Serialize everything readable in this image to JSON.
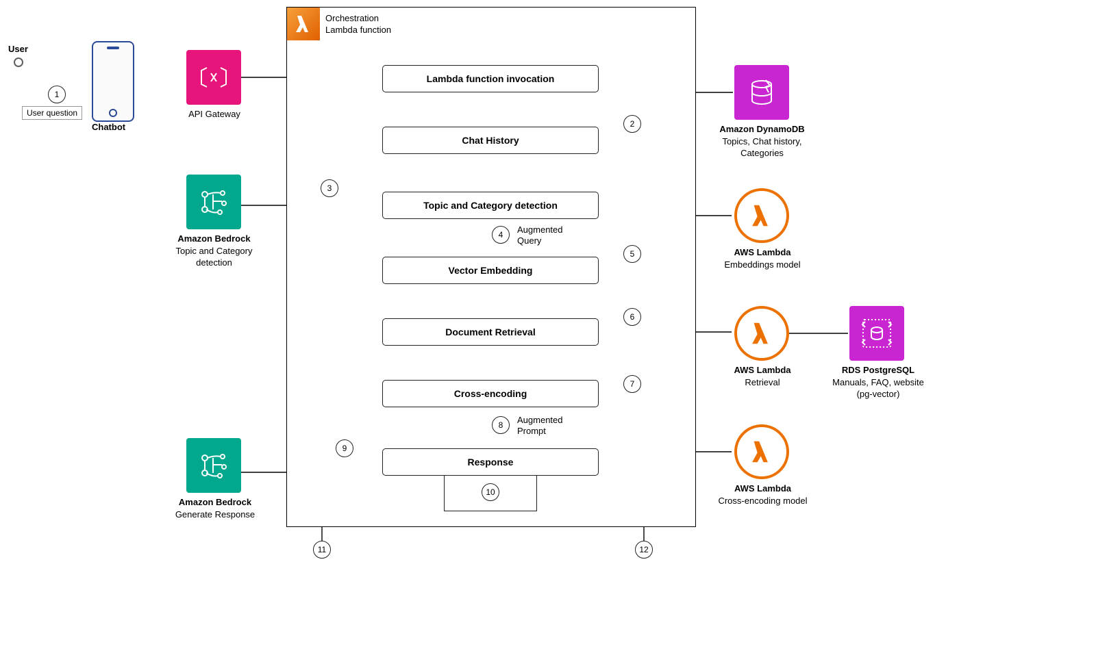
{
  "user": {
    "label": "User"
  },
  "userQuestion": {
    "tag": "User question",
    "step": "1"
  },
  "chatbot": {
    "label": "Chatbot"
  },
  "apiGateway": {
    "label": "API Gateway"
  },
  "bedrockTopic": {
    "title": "Amazon Bedrock",
    "sub": "Topic and Category detection"
  },
  "bedrockResp": {
    "title": "Amazon Bedrock",
    "sub": "Generate Response"
  },
  "orchestration": {
    "line1": "Orchestration",
    "line2": "Lambda function"
  },
  "steps": {
    "invoke": "Lambda function invocation",
    "history": "Chat History",
    "topic": "Topic and Category detection",
    "embed": "Vector Embedding",
    "retrieve": "Document Retrieval",
    "cross": "Cross-encoding",
    "response": "Response"
  },
  "annotations": {
    "augQuery": "Augmented Query",
    "augPrompt": "Augmented Prompt"
  },
  "numbers": {
    "n1": "1",
    "n2": "2",
    "n3": "3",
    "n4": "4",
    "n5": "5",
    "n6": "6",
    "n7": "7",
    "n8": "8",
    "n9": "9",
    "n10": "10",
    "n11": "11",
    "n12": "12"
  },
  "right": {
    "dynamo": {
      "title": "Amazon DynamoDB",
      "sub": "Topics, Chat history, Categories"
    },
    "lambdaEmbed": {
      "title": "AWS Lambda",
      "sub": "Embeddings model"
    },
    "lambdaRetrieve": {
      "title": "AWS Lambda",
      "sub": "Retrieval"
    },
    "lambdaCross": {
      "title": "AWS Lambda",
      "sub": "Cross-encoding model"
    },
    "rds": {
      "title": "RDS PostgreSQL",
      "sub": "Manuals, FAQ, website (pg-vector)"
    }
  },
  "chart_data": {
    "type": "flow-diagram",
    "nodes": [
      {
        "id": "user",
        "label": "User"
      },
      {
        "id": "chatbot",
        "label": "Chatbot"
      },
      {
        "id": "apigw",
        "label": "API Gateway"
      },
      {
        "id": "bedrock_topic",
        "label": "Amazon Bedrock — Topic and Category detection"
      },
      {
        "id": "bedrock_resp",
        "label": "Amazon Bedrock — Generate Response"
      },
      {
        "id": "orchestration",
        "label": "Orchestration Lambda function",
        "group": true
      },
      {
        "id": "invoke",
        "label": "Lambda function invocation",
        "parent": "orchestration"
      },
      {
        "id": "history",
        "label": "Chat History",
        "parent": "orchestration"
      },
      {
        "id": "topic",
        "label": "Topic and Category detection",
        "parent": "orchestration"
      },
      {
        "id": "embed",
        "label": "Vector Embedding",
        "parent": "orchestration"
      },
      {
        "id": "retrieve",
        "label": "Document Retrieval",
        "parent": "orchestration"
      },
      {
        "id": "cross",
        "label": "Cross-encoding",
        "parent": "orchestration"
      },
      {
        "id": "response",
        "label": "Response",
        "parent": "orchestration"
      },
      {
        "id": "dynamo",
        "label": "Amazon DynamoDB — Topics, Chat history, Categories"
      },
      {
        "id": "lambda_embed",
        "label": "AWS Lambda — Embeddings model"
      },
      {
        "id": "lambda_retrieve",
        "label": "AWS Lambda — Retrieval"
      },
      {
        "id": "lambda_cross",
        "label": "AWS Lambda — Cross-encoding model"
      },
      {
        "id": "rds",
        "label": "RDS PostgreSQL — Manuals, FAQ, website (pg-vector)"
      }
    ],
    "edges": [
      {
        "from": "user",
        "to": "chatbot",
        "step": 1,
        "label": "User question"
      },
      {
        "from": "chatbot",
        "to": "apigw"
      },
      {
        "from": "apigw",
        "to": "invoke"
      },
      {
        "from": "invoke",
        "to": "history"
      },
      {
        "from": "history",
        "to": "dynamo",
        "step": 2
      },
      {
        "from": "history",
        "to": "topic"
      },
      {
        "from": "topic",
        "to": "bedrock_topic",
        "step": 3
      },
      {
        "from": "topic",
        "to": "embed",
        "step": 4,
        "label": "Augmented Query"
      },
      {
        "from": "embed",
        "to": "lambda_embed",
        "step": 5
      },
      {
        "from": "embed",
        "to": "retrieve"
      },
      {
        "from": "retrieve",
        "to": "lambda_retrieve",
        "step": 6
      },
      {
        "from": "lambda_retrieve",
        "to": "rds"
      },
      {
        "from": "retrieve",
        "to": "cross"
      },
      {
        "from": "cross",
        "to": "lambda_cross",
        "step": 7
      },
      {
        "from": "cross",
        "to": "response",
        "step": 8,
        "label": "Augmented Prompt"
      },
      {
        "from": "response",
        "to": "bedrock_resp",
        "step": 9
      },
      {
        "from": "response",
        "to": "down",
        "step": 10
      },
      {
        "from": "orchestration",
        "to": "out_left",
        "step": 11
      },
      {
        "from": "orchestration",
        "to": "out_right",
        "step": 12
      }
    ]
  }
}
